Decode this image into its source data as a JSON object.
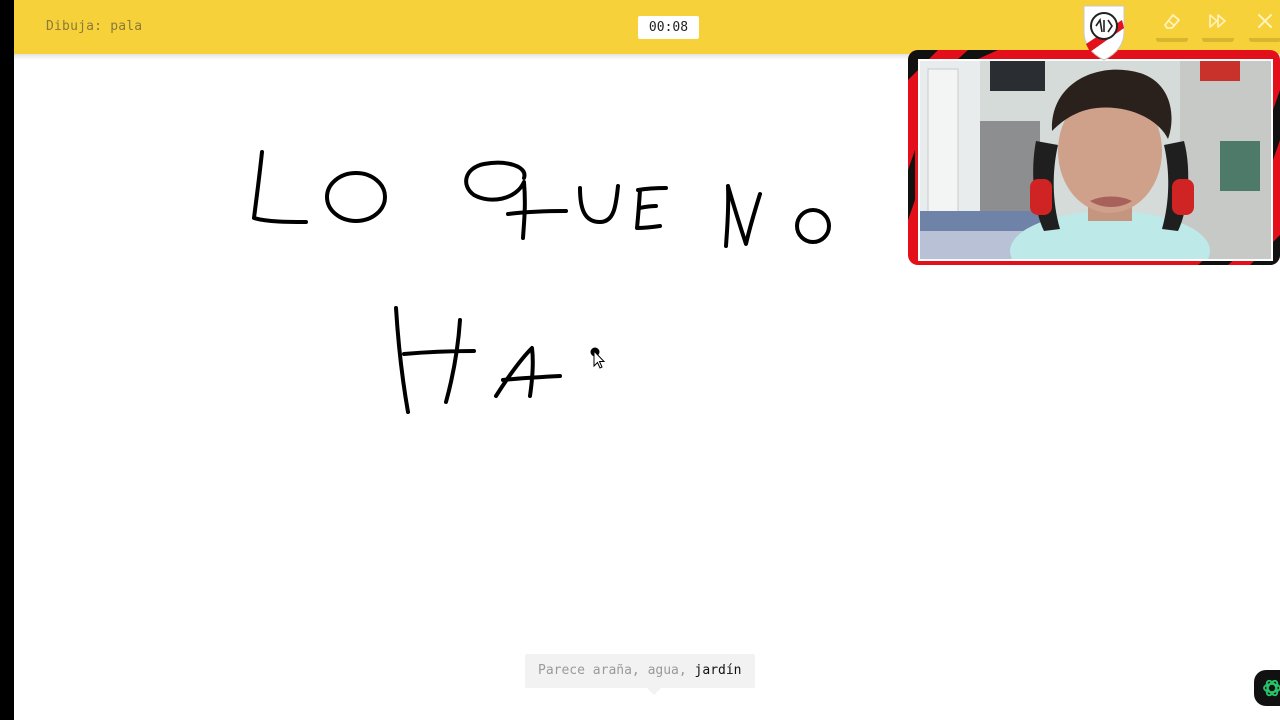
{
  "header": {
    "prompt_text": "Dibuja: pala",
    "timer": "00:08"
  },
  "toolbar": {
    "icons": [
      "eraser-icon",
      "fast-forward-icon",
      "close-icon"
    ]
  },
  "overlay": {
    "webcam_border_color": "#e3101b",
    "crest_icon": "river-plate-crest-icon"
  },
  "guess": {
    "prefix": "Parece araña, agua, ",
    "highlight": "jardín"
  },
  "colors": {
    "header": "#f7d13a",
    "canvas": "#ffffff",
    "ink": "#000000",
    "corner_icon": "#27c46b"
  }
}
